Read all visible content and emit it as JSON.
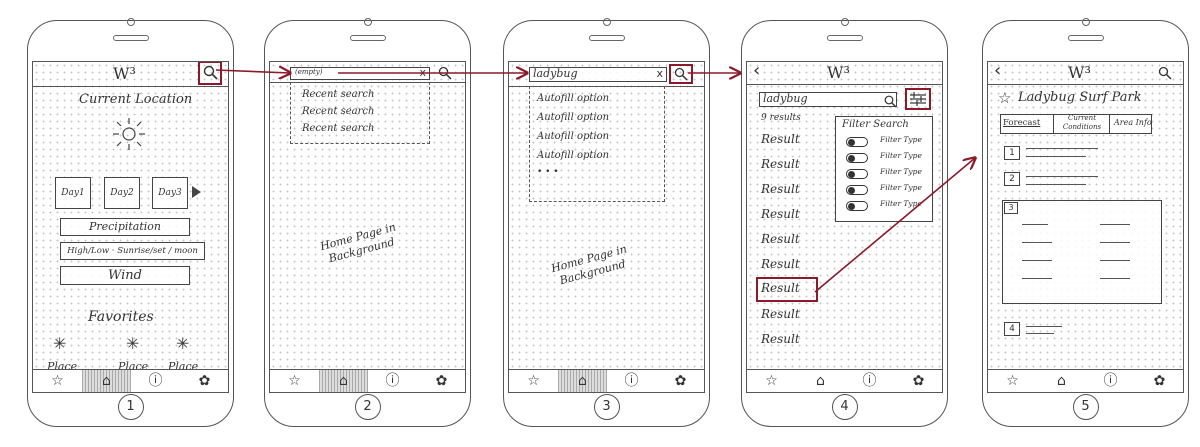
{
  "accent_color": "#8b1a2b",
  "app_logo": "W³",
  "screens": [
    {
      "number": "1",
      "current_location": "Current Location",
      "days": [
        "Day1",
        "Day2",
        "Day3"
      ],
      "precipitation": "Precipitation",
      "details": "High/Low · Sunrise/set / moon",
      "wind": "Wind",
      "favorites_title": "Favorites",
      "places": [
        "Place",
        "Place",
        "Place"
      ]
    },
    {
      "number": "2",
      "search_value": "(empty)",
      "clear": "x",
      "recent": [
        "Recent search",
        "Recent search",
        "Recent search"
      ],
      "background_note": "Home Page in Background"
    },
    {
      "number": "3",
      "search_value": "ladybug",
      "clear": "x",
      "autofill": [
        "Autofill option",
        "Autofill option",
        "Autofill option",
        "Autofill option"
      ],
      "ellipsis": "• • •",
      "background_note": "Home Page in Background"
    },
    {
      "number": "4",
      "search_value": "ladybug",
      "results_count": "9 results",
      "results": [
        "Result",
        "Result",
        "Result",
        "Result",
        "Result",
        "Result",
        "Result",
        "Result",
        "Result"
      ],
      "filter_title": "Filter Search",
      "filter_types": [
        "Filter Type",
        "Filter Type",
        "Filter Type",
        "Filter Type",
        "Filter Type"
      ]
    },
    {
      "number": "5",
      "place_title": "Ladybug Surf Park",
      "tabs": [
        "Forecast",
        "Current Conditions",
        "Area Info"
      ],
      "sections": [
        "1",
        "2",
        "3",
        "4"
      ]
    }
  ],
  "icons": {
    "back": "‹",
    "search": "search-icon",
    "star": "★",
    "home": "⌂",
    "help": "?",
    "gear": "✿"
  }
}
